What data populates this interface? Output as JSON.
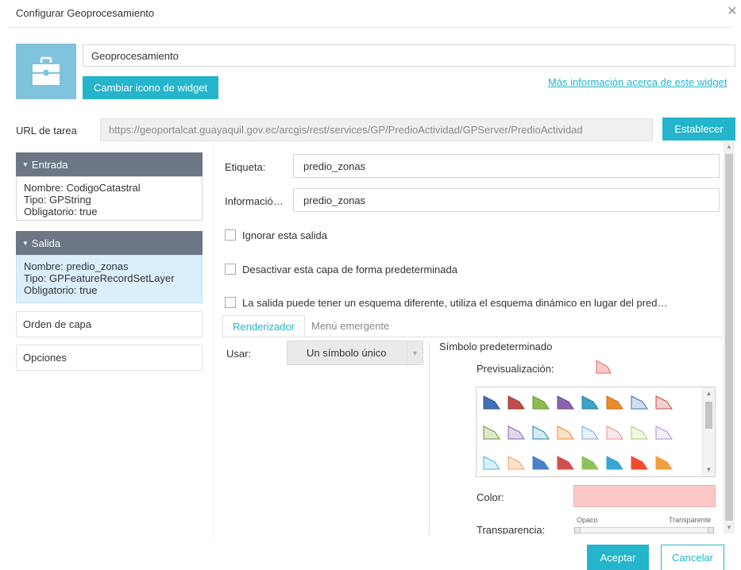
{
  "dialog": {
    "title": "Configurar Geoprocesamiento"
  },
  "widget": {
    "name_value": "Geoprocesamiento",
    "change_icon_label": "Cambiar icono de widget",
    "more_info_link": "Más información acerca de este widget"
  },
  "task_url": {
    "label": "URL de tarea",
    "value": "https://geoportalcat.guayaquil.gov.ec/arcgis/rest/services/GP/PredioActividad/GPServer/PredioActividad",
    "set_label": "Establecer"
  },
  "sidebar": {
    "input": {
      "header": "Entrada",
      "name_line": "Nombre: CodigoCatastral",
      "type_line": "Tipo: GPString",
      "required_line": "Obligatorio: true"
    },
    "output": {
      "header": "Salida",
      "name_line": "Nombre: predio_zonas",
      "type_line": "Tipo: GPFeatureRecordSetLayer",
      "required_line": "Obligatorio: true"
    },
    "layer_order": "Orden de capa",
    "options": "Opciones"
  },
  "form": {
    "label_label": "Etiqueta:",
    "label_value": "predio_zonas",
    "info_label": "Informació…",
    "info_value": "predio_zonas",
    "ignore_output": "Ignorar esta salida",
    "disable_layer": "Desactivar esta capa de forma predeterminada",
    "dynamic_schema": "La salida puede tener un esquema diferente, utiliza el esquema dinámico en lugar del pred…"
  },
  "tabs": {
    "renderer": "Renderizador",
    "popup": "Menú emergente"
  },
  "renderer": {
    "use_label": "Usar:",
    "use_value": "Un símbolo único",
    "default_symbol": "Símbolo predeterminado",
    "preview_label": "Previsualización:",
    "color_label": "Color:",
    "color_value": "#fcc8c8",
    "transparency_label": "Transparencia:",
    "opaque_label": "Opaco",
    "transparent_label": "Transparente"
  },
  "symbols": [
    {
      "fill": "#3f6fb5",
      "stroke": "#2e5590"
    },
    {
      "fill": "#c24b4b",
      "stroke": "#993838"
    },
    {
      "fill": "#8dbb4e",
      "stroke": "#6d943a"
    },
    {
      "fill": "#8a63ad",
      "stroke": "#6b4a89"
    },
    {
      "fill": "#3aa3c6",
      "stroke": "#2b82a0"
    },
    {
      "fill": "#ec8b2c",
      "stroke": "#c46e1e"
    },
    {
      "fill": "#d4dcf0",
      "stroke": "#3f6fb5"
    },
    {
      "fill": "#f0d0d0",
      "stroke": "#c24b4b"
    },
    {
      "fill": "#dceac8",
      "stroke": "#6d943a"
    },
    {
      "fill": "#e2d6ee",
      "stroke": "#8a63ad"
    },
    {
      "fill": "#d2ecf6",
      "stroke": "#2b82a0"
    },
    {
      "fill": "#fbe1c6",
      "stroke": "#ec8b2c"
    },
    {
      "fill": "#e7f0fb",
      "stroke": "#7ea6d6"
    },
    {
      "fill": "#fde7e7",
      "stroke": "#e58c8c"
    },
    {
      "fill": "#f1f8e0",
      "stroke": "#a8cc70"
    },
    {
      "fill": "#f2eefa",
      "stroke": "#a98ec8"
    },
    {
      "fill": "#d7f1fb",
      "stroke": "#49b4d8"
    },
    {
      "fill": "#fde3cc",
      "stroke": "#f0a35a"
    },
    {
      "fill": "#4a80c8",
      "stroke": "#4a80c8"
    },
    {
      "fill": "#cf4f4f",
      "stroke": "#cf4f4f"
    },
    {
      "fill": "#8fc15a",
      "stroke": "#8fc15a"
    },
    {
      "fill": "#34a6d0",
      "stroke": "#34a6d0"
    },
    {
      "fill": "#f24a2a",
      "stroke": "#f24a2a"
    },
    {
      "fill": "#f2a03a",
      "stroke": "#f2a03a"
    }
  ],
  "footer": {
    "ok_label": "Aceptar",
    "cancel_label": "Cancelar"
  },
  "colors": {
    "accent": "#24b5cc",
    "section_header": "#6c7684",
    "selected_bg": "#dbeefb"
  }
}
